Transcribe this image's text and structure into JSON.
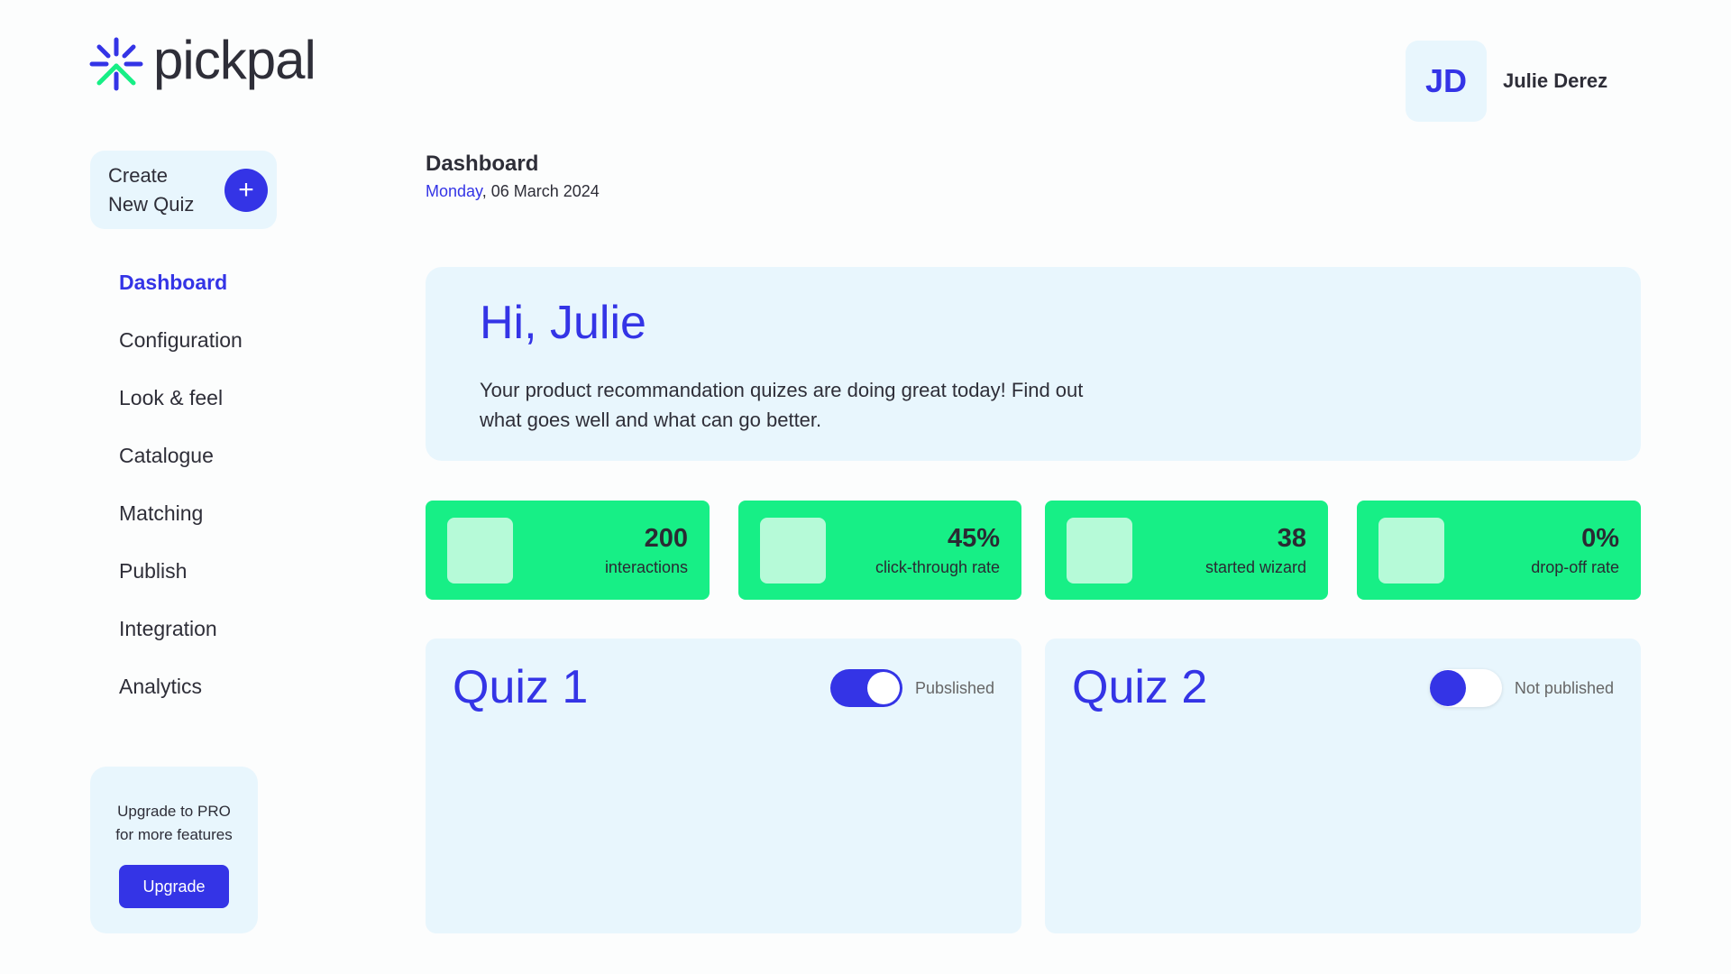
{
  "brand": {
    "name": "pickpal",
    "logo_colors": [
      "#3434e6",
      "#17ef86"
    ]
  },
  "user": {
    "initials": "JD",
    "name": "Julie Derez"
  },
  "sidebar": {
    "create_quiz": {
      "line1": "Create",
      "line2": "New Quiz",
      "icon": "plus-icon"
    },
    "items": [
      {
        "label": "Dashboard",
        "active": true
      },
      {
        "label": "Configuration",
        "active": false
      },
      {
        "label": "Look & feel",
        "active": false
      },
      {
        "label": "Catalogue",
        "active": false
      },
      {
        "label": "Matching",
        "active": false
      },
      {
        "label": "Publish",
        "active": false
      },
      {
        "label": "Integration",
        "active": false
      },
      {
        "label": "Analytics",
        "active": false
      }
    ],
    "upgrade": {
      "line1": "Upgrade to PRO",
      "line2": "for more features",
      "button": "Upgrade"
    }
  },
  "header": {
    "title": "Dashboard",
    "day": "Monday",
    "date": ", 06 March 2024"
  },
  "hero": {
    "greeting": "Hi, Julie",
    "text": "Your product recommandation quizes are doing great today! Find out what goes well and what can go better."
  },
  "stats": [
    {
      "value": "200",
      "label": "interactions"
    },
    {
      "value": "45%",
      "label": "click-through rate"
    },
    {
      "value": "38",
      "label": "started wizard"
    },
    {
      "value": "0%",
      "label": "drop-off rate"
    }
  ],
  "quizzes": [
    {
      "title": "Quiz 1",
      "published": true,
      "status": "Pubslished"
    },
    {
      "title": "Quiz 2",
      "published": false,
      "status": "Not published"
    }
  ],
  "colors": {
    "accent": "#3434e6",
    "green": "#17ef86",
    "card_bg": "#e8f6fd"
  }
}
